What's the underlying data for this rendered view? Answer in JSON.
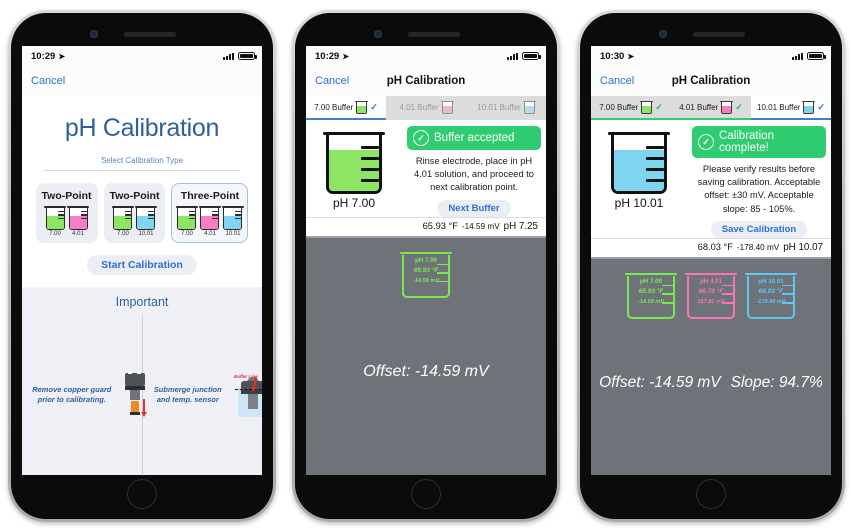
{
  "colors": {
    "accent_blue": "#2f6fd0",
    "hero_blue": "#2f5f9e",
    "green_banner": "#2fcc71",
    "buffer_700": "#8ee563",
    "buffer_401": "#f77ec2",
    "buffer_1001": "#7fd4f0",
    "panel_gray": "#6e7379"
  },
  "phone1": {
    "status": {
      "time": "10:29",
      "location_icon": "location-arrow",
      "signal": "signal-bars",
      "battery": "battery-full"
    },
    "nav": {
      "cancel": "Cancel"
    },
    "hero_title": "pH Calibration",
    "subtitle": "Select Calibration Type",
    "cards": [
      {
        "title": "Two-Point",
        "selected": false,
        "beakers": [
          {
            "label": "7.00",
            "color": "#8ee563"
          },
          {
            "label": "4.01",
            "color": "#f77ec2"
          }
        ]
      },
      {
        "title": "Two-Point",
        "selected": false,
        "beakers": [
          {
            "label": "7.00",
            "color": "#8ee563"
          },
          {
            "label": "10.01",
            "color": "#7fd4f0"
          }
        ]
      },
      {
        "title": "Three-Point",
        "selected": true,
        "beakers": [
          {
            "label": "7.00",
            "color": "#8ee563"
          },
          {
            "label": "4.01",
            "color": "#f77ec2"
          },
          {
            "label": "10.01",
            "color": "#7fd4f0"
          }
        ]
      }
    ],
    "start_button": "Start Calibration",
    "important_title": "Important",
    "tips": [
      {
        "text": "Remove copper guard prior to calibrating.",
        "icon": "probe-copper-guard-icon"
      },
      {
        "text": "Submerge junction and temp. sensor",
        "icon": "probe-submerge-icon",
        "callout": "Buffer Line"
      }
    ]
  },
  "phone2": {
    "status": {
      "time": "10:29"
    },
    "nav": {
      "cancel": "Cancel",
      "title": "pH Calibration"
    },
    "tabs": [
      {
        "label": "7.00 Buffer",
        "color": "#8ee563",
        "state": "active",
        "check": "✓"
      },
      {
        "label": "4.01 Buffer",
        "color": "#e8b8d8",
        "state": "pending",
        "check": ""
      },
      {
        "label": "10.01 Buffer",
        "color": "#bcdcea",
        "state": "pending",
        "check": ""
      }
    ],
    "beaker": {
      "label": "pH 7.00",
      "color": "#8ee563"
    },
    "banner": {
      "icon": "check-circle-icon",
      "text": "Buffer accepted"
    },
    "instructions": "Rinse electrode, place in pH 4.01 solution, and proceed to next calibration point.",
    "action_button": "Next Buffer",
    "readout": {
      "temperature": "65.93 °F",
      "millivolts": "-14.59 mV",
      "ph": "pH 7.25"
    },
    "summary_beakers": [
      {
        "ph": "pH 7.00",
        "temp": "65.93 °F",
        "mv": "-14.59 mV",
        "color": "#7ce84f"
      }
    ],
    "results": [
      "Offset: -14.59 mV"
    ]
  },
  "phone3": {
    "status": {
      "time": "10:30"
    },
    "nav": {
      "cancel": "Cancel",
      "title": "pH Calibration"
    },
    "tabs": [
      {
        "label": "7.00 Buffer",
        "color": "#8ee563",
        "state": "done",
        "check": "✓"
      },
      {
        "label": "4.01 Buffer",
        "color": "#f77ec2",
        "state": "done",
        "check": "✓"
      },
      {
        "label": "10.01 Buffer",
        "color": "#7fd4f0",
        "state": "active",
        "check": "✓"
      }
    ],
    "beaker": {
      "label": "pH 10.01",
      "color": "#7fd4f0"
    },
    "banner": {
      "icon": "check-circle-icon",
      "text": "Calibration complete!"
    },
    "instructions": "Please verify results before saving calibration. Acceptable offset: ±30 mV. Acceptable slope: 85 - 105%.",
    "action_button": "Save Calibration",
    "readout": {
      "temperature": "68.03 °F",
      "millivolts": "-178.40 mV",
      "ph": "pH 10.07"
    },
    "summary_beakers": [
      {
        "ph": "pH 7.00",
        "temp": "65.93 °F",
        "mv": "-14.59 mV",
        "color": "#7ce84f"
      },
      {
        "ph": "pH 4.01",
        "temp": "66.75 °F",
        "mv": "157.83 mV",
        "color": "#fa73b9"
      },
      {
        "ph": "pH 10.01",
        "temp": "68.03 °F",
        "mv": "-178.40 mV",
        "color": "#5ec8f0"
      }
    ],
    "results": [
      "Offset: -14.59 mV",
      "Slope: 94.7%"
    ]
  }
}
